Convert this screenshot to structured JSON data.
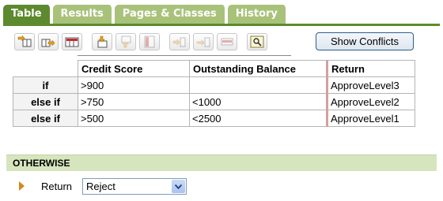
{
  "tabs": [
    {
      "label": "Table",
      "active": true
    },
    {
      "label": "Results",
      "active": false
    },
    {
      "label": "Pages & Classes",
      "active": false
    },
    {
      "label": "History",
      "active": false
    }
  ],
  "toolbar": {
    "buttons": [
      {
        "icon": "insert-column-before-icon",
        "enabled": true
      },
      {
        "icon": "insert-column-after-icon",
        "enabled": true
      },
      {
        "icon": "delete-column-icon",
        "enabled": true
      },
      {
        "icon": "insert-row-before-icon",
        "enabled": true
      },
      {
        "icon": "insert-row-after-icon",
        "enabled": false
      },
      {
        "icon": "delete-row-icon",
        "enabled": false
      },
      {
        "icon": "move-column-left-icon",
        "enabled": false
      },
      {
        "icon": "move-column-right-icon",
        "enabled": false
      },
      {
        "icon": "merge-icon",
        "enabled": false
      },
      {
        "icon": "properties-icon",
        "enabled": true
      }
    ],
    "show_conflicts_label": "Show Conflicts"
  },
  "table": {
    "headers": [
      "Credit Score",
      "Outstanding Balance",
      "Return"
    ],
    "rows": [
      {
        "condition": "if",
        "credit": ">900",
        "balance": "",
        "return": "ApproveLevel3"
      },
      {
        "condition": "else if",
        "credit": ">750",
        "balance": "<1000",
        "return": "ApproveLevel2"
      },
      {
        "condition": "else if",
        "credit": ">500",
        "balance": "<2500",
        "return": "ApproveLevel1"
      }
    ]
  },
  "otherwise": {
    "title": "OTHERWISE",
    "return_label": "Return",
    "return_value": "Reject"
  },
  "colors": {
    "tab_active": "#5d8a2e",
    "tab_inactive": "#a8c27a",
    "otherwise_bg": "#d7e5bf",
    "return_divider": "#d4a0a0"
  }
}
